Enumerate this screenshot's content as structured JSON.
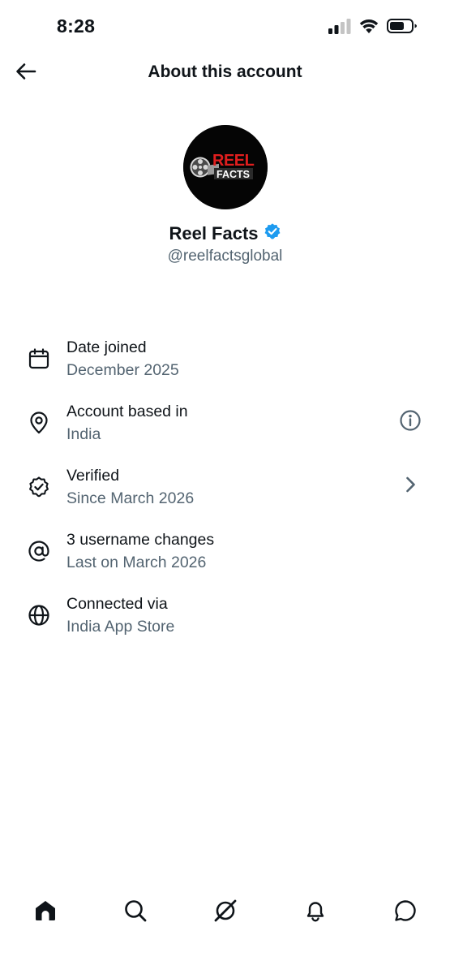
{
  "status_bar": {
    "time": "8:28",
    "icons": [
      "cellular-signal-icon",
      "wifi-icon",
      "battery-icon"
    ]
  },
  "header": {
    "title": "About this account",
    "back_icon": "arrow-left-icon"
  },
  "profile": {
    "avatar_logo": "REEL FACTS",
    "display_name": "Reel Facts",
    "verified_badge": "verified-badge-icon",
    "handle": "@reelfactsglobal"
  },
  "info_items": [
    {
      "icon": "calendar-icon",
      "title": "Date joined",
      "subtitle": "December 2025"
    },
    {
      "icon": "location-pin-icon",
      "title": "Account based in",
      "subtitle": "India",
      "action_icon": "info-icon"
    },
    {
      "icon": "verified-check-icon",
      "title": "Verified",
      "subtitle": "Since March 2026",
      "action_icon": "chevron-right-icon"
    },
    {
      "icon": "at-sign-icon",
      "title": "3 username changes",
      "subtitle": "Last on March 2026"
    },
    {
      "icon": "globe-icon",
      "title": "Connected via",
      "subtitle": "India App Store"
    }
  ],
  "bottom_nav": [
    "home-icon",
    "search-icon",
    "grok-icon",
    "notifications-bell-icon",
    "messages-icon"
  ],
  "colors": {
    "text_primary": "#0f1419",
    "text_secondary": "#536471",
    "verified_blue": "#1d9bf0",
    "logo_red": "#e01e1e",
    "background": "#ffffff"
  }
}
